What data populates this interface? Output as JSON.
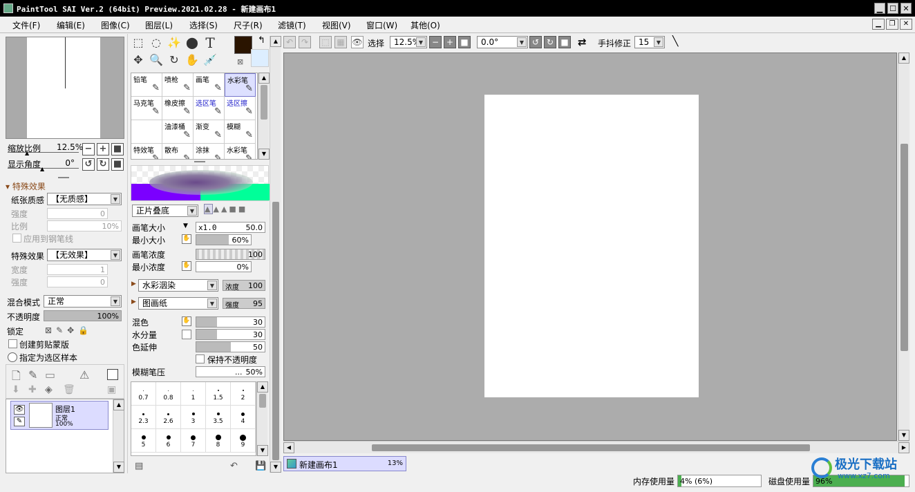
{
  "title_bar": {
    "title": "PaintTool SAI Ver.2 (64bit) Preview.2021.02.28 - 新建画布1",
    "minimize": "▁",
    "maximize": "☐",
    "close": "✕"
  },
  "menu": [
    "文件(F)",
    "编辑(E)",
    "图像(C)",
    "图层(L)",
    "选择(S)",
    "尺子(R)",
    "滤镜(T)",
    "视图(V)",
    "窗口(W)",
    "其他(O)"
  ],
  "navigator": {
    "zoom_label": "缩放比例",
    "zoom_value": "12.5%",
    "angle_label": "显示角度",
    "angle_value": "0°"
  },
  "effects": {
    "header": "特殊效果",
    "paper_label": "纸张质感",
    "paper_value": "【无质感】",
    "strength_label": "强度",
    "strength_value": "0",
    "scale_label": "比例",
    "scale_value": "10%",
    "apply_pen": "应用到钢笔线",
    "effect_label": "特殊效果",
    "effect_value": "【无效果】",
    "width_label": "宽度",
    "width_value": "1",
    "strength2_label": "强度",
    "strength2_value": "0"
  },
  "layer_props": {
    "blend_label": "混合模式",
    "blend_value": "正常",
    "opacity_label": "不透明度",
    "opacity_value": "100%",
    "opacity_fraction": 1.0,
    "lock_label": "锁定",
    "clip": "创建剪贴蒙版",
    "sample": "指定为选区样本"
  },
  "layers": [
    {
      "name": "图层1",
      "mode": "正常",
      "opacity": "100%"
    }
  ],
  "tools": {
    "text_tool": "T"
  },
  "brushes": [
    {
      "name": "铅笔",
      "selected": false,
      "blue": false
    },
    {
      "name": "喷枪",
      "selected": false,
      "blue": false
    },
    {
      "name": "画笔",
      "selected": false,
      "blue": false
    },
    {
      "name": "水彩笔",
      "selected": true,
      "blue": false
    },
    {
      "name": "马克笔",
      "selected": false,
      "blue": false
    },
    {
      "name": "橡皮擦",
      "selected": false,
      "blue": false
    },
    {
      "name": "选区笔",
      "selected": false,
      "blue": true
    },
    {
      "name": "选区擦",
      "selected": false,
      "blue": true
    },
    {
      "name": "",
      "selected": false,
      "blue": false
    },
    {
      "name": "油漆桶",
      "selected": false,
      "blue": false
    },
    {
      "name": "渐变",
      "selected": false,
      "blue": false
    },
    {
      "name": "模糊",
      "selected": false,
      "blue": false
    },
    {
      "name": "特效笔",
      "selected": false,
      "blue": false
    },
    {
      "name": "散布",
      "selected": false,
      "blue": false
    },
    {
      "name": "涂抹",
      "selected": false,
      "blue": false
    },
    {
      "name": "水彩笔",
      "selected": false,
      "blue": false
    }
  ],
  "brush_settings": {
    "mode": "正片叠底",
    "size_label": "画笔大小",
    "size_mult": "x1.0",
    "size_value": "50.0",
    "min_size_label": "最小大小",
    "min_size_value": "60%",
    "min_size_fraction": 0.6,
    "density_label": "画笔浓度",
    "density_value": "100",
    "min_density_label": "最小浓度",
    "min_density_value": "0%",
    "blend_type": "水彩洇染",
    "blend_type_label": "浓度",
    "blend_type_value": "100",
    "texture": "图画纸",
    "texture_label": "强度",
    "texture_value": "95",
    "mix_label": "混色",
    "mix_value": "30",
    "mix_fraction": 0.3,
    "water_label": "水分量",
    "water_value": "30",
    "water_fraction": 0.3,
    "stretch_label": "色延伸",
    "stretch_value": "50",
    "stretch_fraction": 0.5,
    "keep_opacity": "保持不透明度",
    "blur_label": "模糊笔压",
    "blur_dots": "...",
    "blur_value": "50%"
  },
  "tips": [
    {
      "label": "0.7",
      "d": 1
    },
    {
      "label": "0.8",
      "d": 1
    },
    {
      "label": "1",
      "d": 1
    },
    {
      "label": "1.5",
      "d": 2
    },
    {
      "label": "2",
      "d": 2
    },
    {
      "label": "2.3",
      "d": 3
    },
    {
      "label": "2.6",
      "d": 3
    },
    {
      "label": "3",
      "d": 4
    },
    {
      "label": "3.5",
      "d": 4
    },
    {
      "label": "4",
      "d": 5
    },
    {
      "label": "5",
      "d": 6
    },
    {
      "label": "6",
      "d": 6
    },
    {
      "label": "7",
      "d": 7
    },
    {
      "label": "8",
      "d": 8
    },
    {
      "label": "9",
      "d": 9
    }
  ],
  "toolbar": {
    "select_label": "选择",
    "zoom_value": "12.5%",
    "angle_value": "0.0°",
    "stab_label": "手抖修正",
    "stab_value": "15"
  },
  "colors": {
    "foreground": "#2a1400",
    "background": "#ddeeff",
    "canvas_bg": "#acacac",
    "layer_sel": "#dcdcff"
  },
  "doc_tab": {
    "name": "新建画布1",
    "zoom": "13%"
  },
  "status": {
    "mem_label": "内存使用量",
    "mem_value": "4% (6%)",
    "mem_fraction": 0.04,
    "disk_label": "磁盘使用量",
    "disk_value": "96%",
    "disk_fraction": 0.96
  },
  "watermark": {
    "text": "极光下载站",
    "url": "www.xz7.com"
  }
}
